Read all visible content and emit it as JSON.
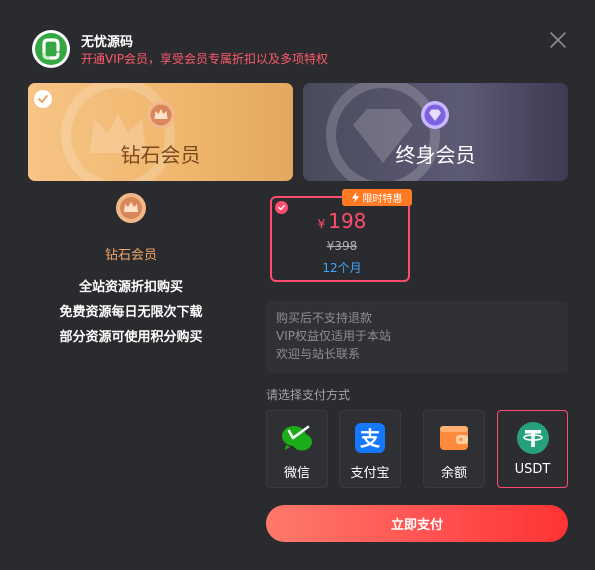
{
  "header": {
    "site_name": "无忧源码",
    "subtitle": "开通VIP会员，享受会员专属折扣以及多项特权"
  },
  "plans": [
    {
      "name": "钻石会员",
      "selected": true
    },
    {
      "name": "终身会员",
      "selected": false
    }
  ],
  "selected_plan": {
    "title": "钻石会员",
    "benefits": [
      "全站资源折扣购买",
      "免费资源每日无限次下载",
      "部分资源可使用积分购买"
    ]
  },
  "price": {
    "promo_label": "限时特惠",
    "currency": "¥",
    "amount": "198",
    "original": "¥398",
    "period": "12个月"
  },
  "notice": [
    "购买后不支持退款",
    "VIP权益仅适用于本站",
    "欢迎与站长联系"
  ],
  "payment": {
    "label": "请选择支付方式",
    "methods": [
      {
        "label": "微信",
        "icon": "wechat-icon",
        "color": "#1aad19"
      },
      {
        "label": "支付宝",
        "icon": "alipay-icon",
        "color": "#1677ff"
      },
      {
        "label": "余额",
        "icon": "wallet-icon",
        "color": "#ff8a3d"
      },
      {
        "label": "USDT",
        "icon": "tether-icon",
        "color": "#26a17b"
      }
    ],
    "selected": "USDT",
    "pay_button": "立即支付"
  },
  "colors": {
    "accent": "#ff4d6d",
    "highlight": "#3fa7ff",
    "gold": "#f0a66a"
  }
}
